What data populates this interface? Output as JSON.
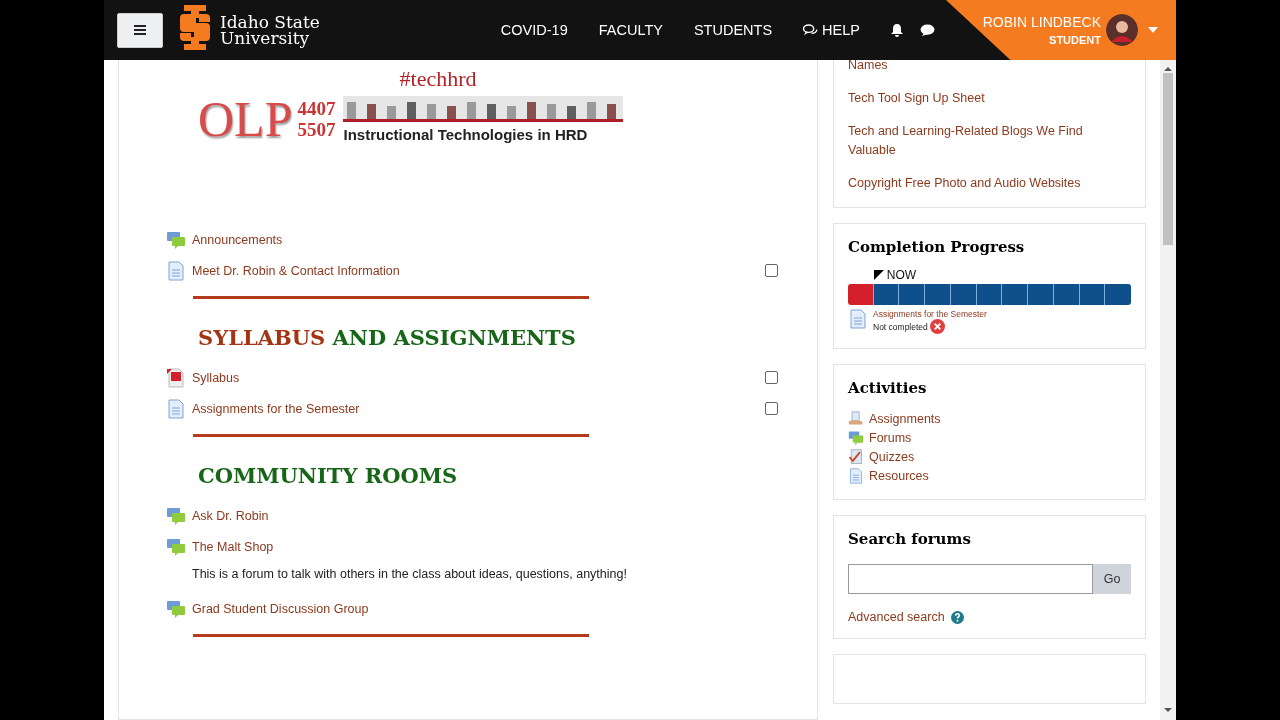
{
  "navbar": {
    "brand": [
      "Idaho State",
      "University"
    ],
    "links": [
      {
        "label": "COVID-19",
        "kind": "text"
      },
      {
        "label": "FACULTY",
        "kind": "text"
      },
      {
        "label": "STUDENTS",
        "kind": "text"
      },
      {
        "label": "HELP",
        "kind": "help"
      }
    ],
    "user": {
      "name": "ROBIN LINDBECK",
      "role": "STUDENT"
    }
  },
  "banner": {
    "hashtag": "#techhrd",
    "code": "OLP",
    "numbers": [
      "4407",
      "5507"
    ],
    "title": "Instructional Technologies in HRD"
  },
  "sections": [
    {
      "items": [
        {
          "kind": "forum",
          "label": "Announcements"
        },
        {
          "kind": "page",
          "label": "Meet Dr. Robin & Contact Information",
          "checked": false
        }
      ]
    },
    {
      "heading": [
        {
          "text": "SYLLABUS",
          "color": "#a33414"
        },
        {
          "text": "AND ASSIGNMENTS",
          "color": "#176617"
        }
      ],
      "items": [
        {
          "kind": "pdf",
          "label": "Syllabus",
          "checked": false
        },
        {
          "kind": "page",
          "label": "Assignments for the Semester",
          "checked": false
        }
      ]
    },
    {
      "heading": [
        {
          "text": "COMMUNITY ROOMS",
          "color": "#176617"
        }
      ],
      "items": [
        {
          "kind": "forum",
          "label": "Ask Dr. Robin"
        },
        {
          "kind": "forum",
          "label": "The Malt Shop",
          "description": "This is a forum to talk with others in the class about ideas, questions, anything!"
        },
        {
          "kind": "forum",
          "label": "Grad Student Discussion Group"
        }
      ]
    }
  ],
  "links_block": {
    "links": [
      "Names",
      "Tech Tool Sign Up Sheet",
      "Tech and Learning-Related Blogs We Find Valuable",
      "Copyright Free Photo and Audio Websites"
    ]
  },
  "completion": {
    "title": "Completion Progress",
    "now_label": "NOW",
    "segments": [
      {
        "color": "#d3202b",
        "now": false
      },
      {
        "color": "#0f4f8c",
        "now": true
      },
      {
        "color": "#0f4f8c",
        "now": false
      },
      {
        "color": "#0f4f8c",
        "now": false
      },
      {
        "color": "#0f4f8c",
        "now": false
      },
      {
        "color": "#0f4f8c",
        "now": false
      },
      {
        "color": "#0f4f8c",
        "now": false
      },
      {
        "color": "#0f4f8c",
        "now": false
      },
      {
        "color": "#0f4f8c",
        "now": false
      },
      {
        "color": "#0f4f8c",
        "now": false
      },
      {
        "color": "#0f4f8c",
        "now": false
      }
    ],
    "info": {
      "activity": "Assignments for the Semester",
      "status": "Not completed"
    }
  },
  "activities": {
    "title": "Activities",
    "items": [
      {
        "kind": "assignment",
        "label": "Assignments"
      },
      {
        "kind": "forum",
        "label": "Forums"
      },
      {
        "kind": "quiz",
        "label": "Quizzes"
      },
      {
        "kind": "page",
        "label": "Resources"
      }
    ]
  },
  "search_forums": {
    "title": "Search forums",
    "button": "Go",
    "advanced": "Advanced search"
  }
}
